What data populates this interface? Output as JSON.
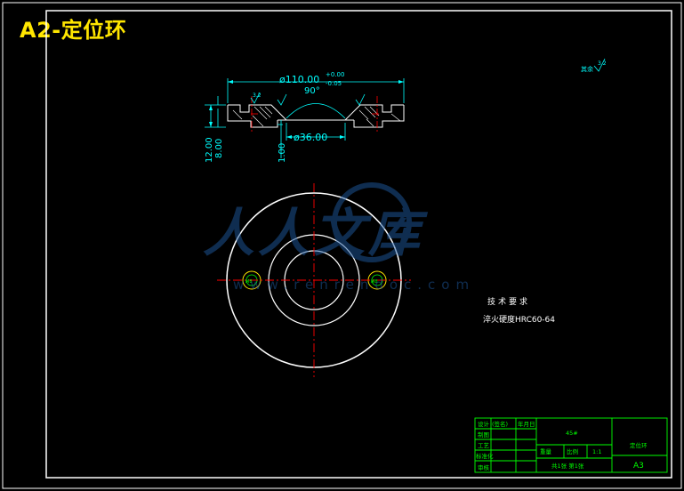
{
  "drawing": {
    "title": "A2-定位环"
  },
  "section_view": {
    "dim_outer_diameter_main": "ø110.00",
    "dim_outer_diameter_tol_plus": "+0.00",
    "dim_outer_diameter_tol_minus": "-0.05",
    "dim_inner_diameter": "ø36.00",
    "dim_angle": "90°",
    "dim_height_total": "12.00",
    "dim_height_inner": "8.00",
    "dim_small": "1.00",
    "roughness_left": "3.2"
  },
  "roughness_general": {
    "value": "3.2",
    "note": "其余"
  },
  "plan_view": {
    "hole_left": "M8",
    "hole_right": "M8"
  },
  "tech_requirements": {
    "heading": "技术要求",
    "line1": "淬火硬度HRC60-64"
  },
  "title_block": {
    "row_labels": [
      "设计",
      "制图",
      "工艺",
      "标准化",
      "审核"
    ],
    "col_labels": [
      "(签名)",
      "年月日"
    ],
    "material": "45#",
    "weight_label": "重量",
    "scale_label": "比例",
    "scale_value": "1:1",
    "sheets": "共1张 第1张",
    "part_name": "定位环",
    "sheet_size": "A3"
  },
  "watermark": {
    "text": "人人文库",
    "url": "www.renrendoc.com"
  },
  "colors": {
    "background": "#000000",
    "outline": "#ffffff",
    "dimension": "#00ffff",
    "centerline": "#ff0000",
    "title_block": "#00ff00",
    "title_text": "#ffe600",
    "watermark": "#1e5aa0"
  }
}
